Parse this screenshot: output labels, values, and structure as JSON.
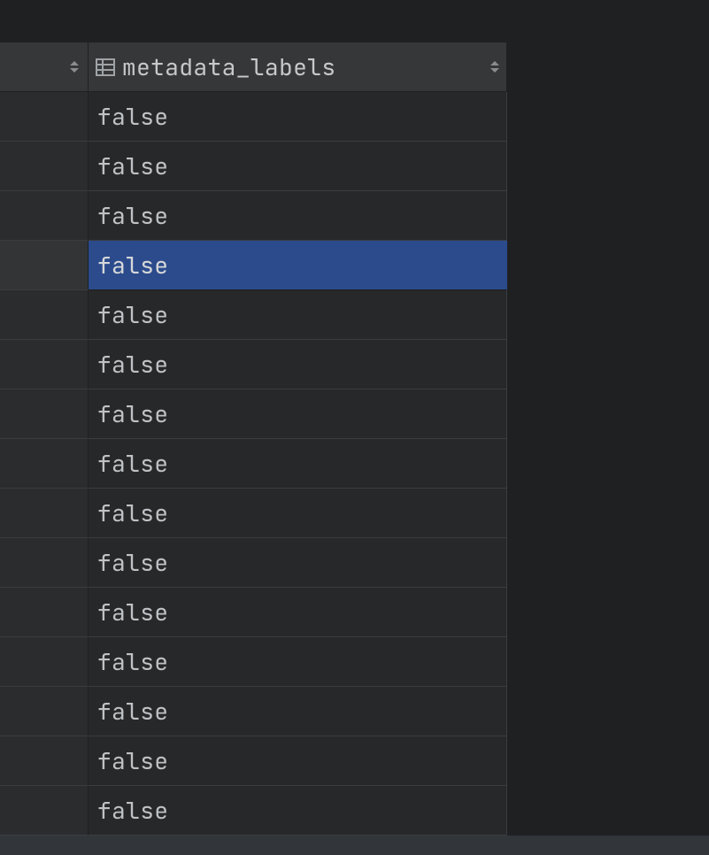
{
  "header": {
    "column_name": "metadata_labels"
  },
  "rows": [
    {
      "value": "false",
      "selected": false
    },
    {
      "value": "false",
      "selected": false
    },
    {
      "value": "false",
      "selected": false
    },
    {
      "value": "false",
      "selected": true
    },
    {
      "value": "false",
      "selected": false
    },
    {
      "value": "false",
      "selected": false
    },
    {
      "value": "false",
      "selected": false
    },
    {
      "value": "false",
      "selected": false
    },
    {
      "value": "false",
      "selected": false
    },
    {
      "value": "false",
      "selected": false
    },
    {
      "value": "false",
      "selected": false
    },
    {
      "value": "false",
      "selected": false
    },
    {
      "value": "false",
      "selected": false
    },
    {
      "value": "false",
      "selected": false
    },
    {
      "value": "false",
      "selected": false
    }
  ]
}
